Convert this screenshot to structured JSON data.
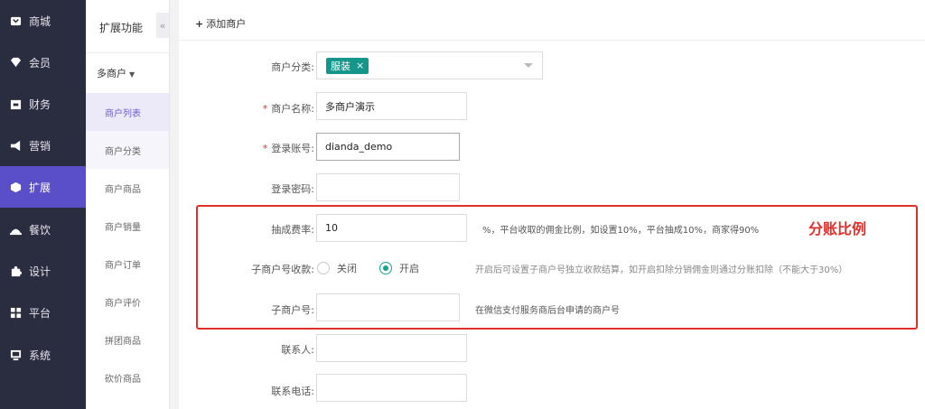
{
  "nav": {
    "items": [
      {
        "label": "商城",
        "icon": "shop-icon"
      },
      {
        "label": "会员",
        "icon": "member-icon"
      },
      {
        "label": "财务",
        "icon": "finance-icon"
      },
      {
        "label": "营销",
        "icon": "megaphone-icon"
      },
      {
        "label": "扩展",
        "icon": "cube-icon",
        "active": true
      },
      {
        "label": "餐饮",
        "icon": "dining-icon"
      },
      {
        "label": "设计",
        "icon": "puzzle-icon"
      },
      {
        "label": "平台",
        "icon": "grid-icon"
      },
      {
        "label": "系统",
        "icon": "system-icon"
      }
    ]
  },
  "subnav": {
    "title": "扩展功能",
    "collapse": "«",
    "group": "多商户",
    "items": [
      "商户列表",
      "商户分类",
      "商户商品",
      "商户销量",
      "商户订单",
      "商户评价",
      "拼团商品",
      "砍价商品"
    ]
  },
  "form": {
    "header": "添加商户",
    "category_label": "商户分类:",
    "category_tag": "服装",
    "category_tag_remove": "×",
    "name_label": "商户名称:",
    "name_value": "多商户演示",
    "account_label": "登录账号:",
    "account_value": "dianda_demo",
    "password_label": "登录密码:",
    "password_value": "",
    "commission_label": "抽成费率:",
    "commission_value": "10",
    "commission_hint": "%，平台收取的佣金比例，如设置10%，平台抽成10%，商家得90%",
    "submch_collect_label": "子商户号收款:",
    "radio_off": "关闭",
    "radio_on": "开启",
    "submch_collect_hint": "开启后可设置子商户号独立收款结算，如开启扣除分销佣金则通过分账扣除（不能大于30%）",
    "submch_no_label": "子商户号:",
    "submch_no_value": "",
    "submch_no_hint": "在微信支付服务商后台申请的商户号",
    "contact_label": "联系人:",
    "contact_value": "",
    "phone_label": "联系电话:",
    "phone_value": ""
  },
  "annotation": {
    "text": "分账比例",
    "color": "#e0302b"
  },
  "colors": {
    "accent": "#5a4ec9",
    "tag": "#15968a",
    "radio_on": "#17a390",
    "required": "#e0302b"
  }
}
